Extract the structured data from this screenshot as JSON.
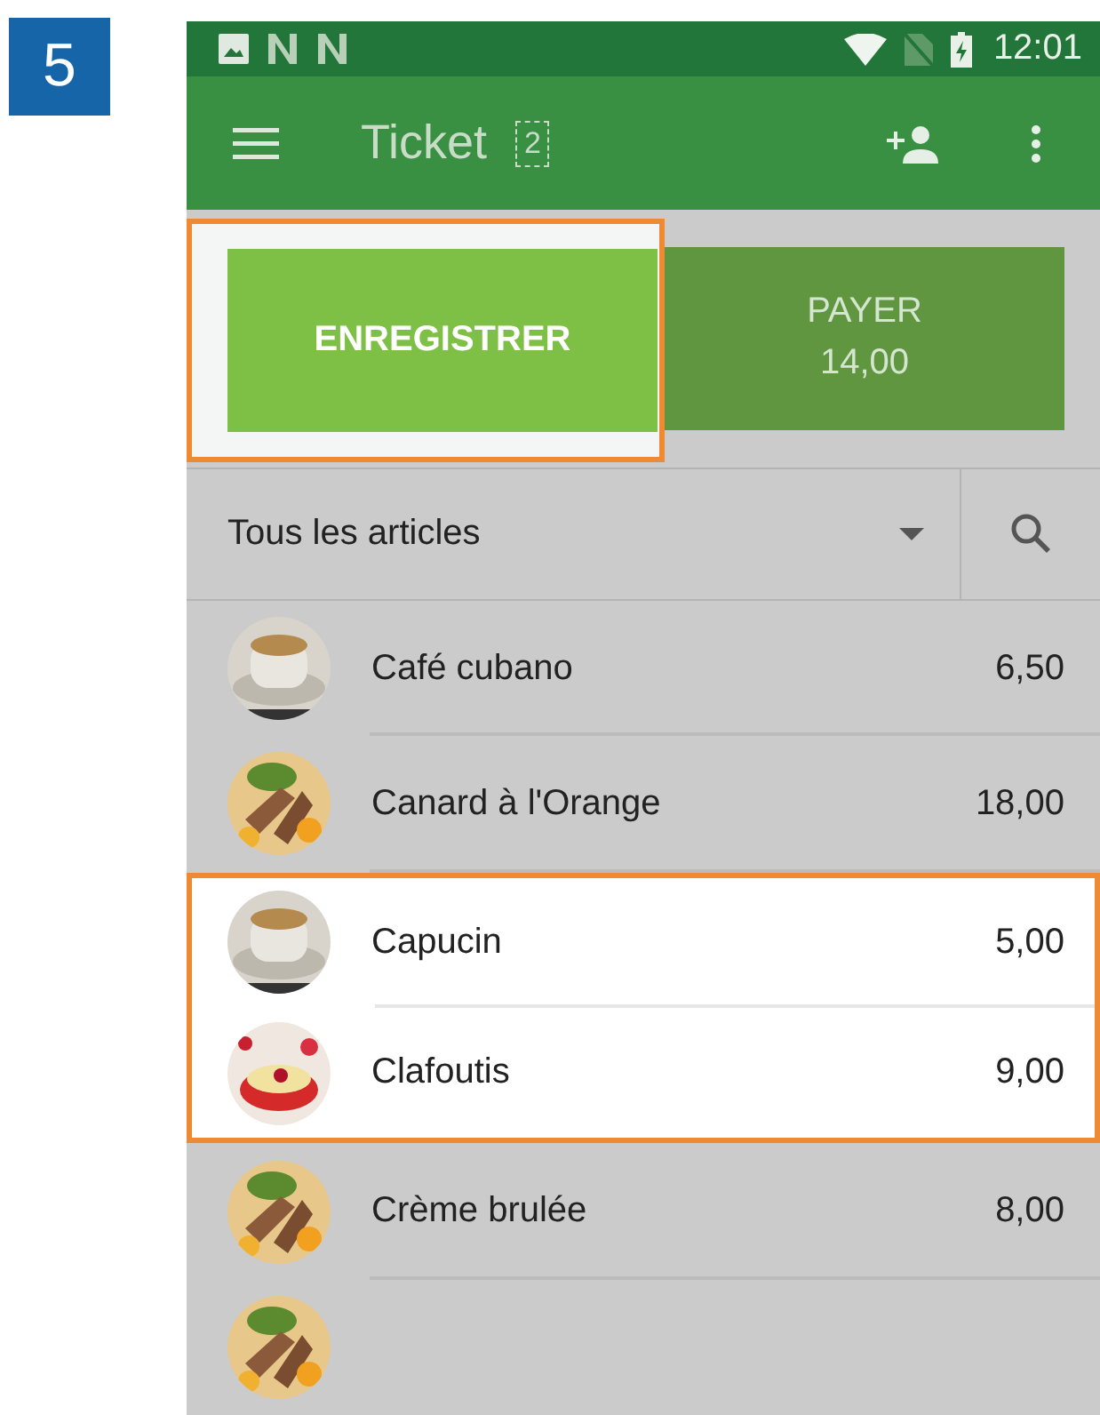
{
  "step_badge": "5",
  "status_bar": {
    "time": "12:01"
  },
  "app_bar": {
    "title": "Ticket",
    "ticket_count": "2"
  },
  "actions": [
    {
      "kind": "save",
      "label": "ENREGISTRER",
      "highlighted": true
    },
    {
      "kind": "pay",
      "label": "PAYER",
      "amount": "14,00",
      "highlighted": false
    }
  ],
  "category_filter": {
    "value": "Tous les articles"
  },
  "items": [
    {
      "name": "Café cubano",
      "price": "6,50",
      "highlighted": false
    },
    {
      "name": "Canard à l'Orange",
      "price": "18,00",
      "highlighted": false
    },
    {
      "name": "Capucin",
      "price": "5,00",
      "highlighted": true
    },
    {
      "name": "Clafoutis",
      "price": "9,00",
      "highlighted": true
    },
    {
      "name": "Crème brulée",
      "price": "8,00",
      "highlighted": false
    }
  ]
}
